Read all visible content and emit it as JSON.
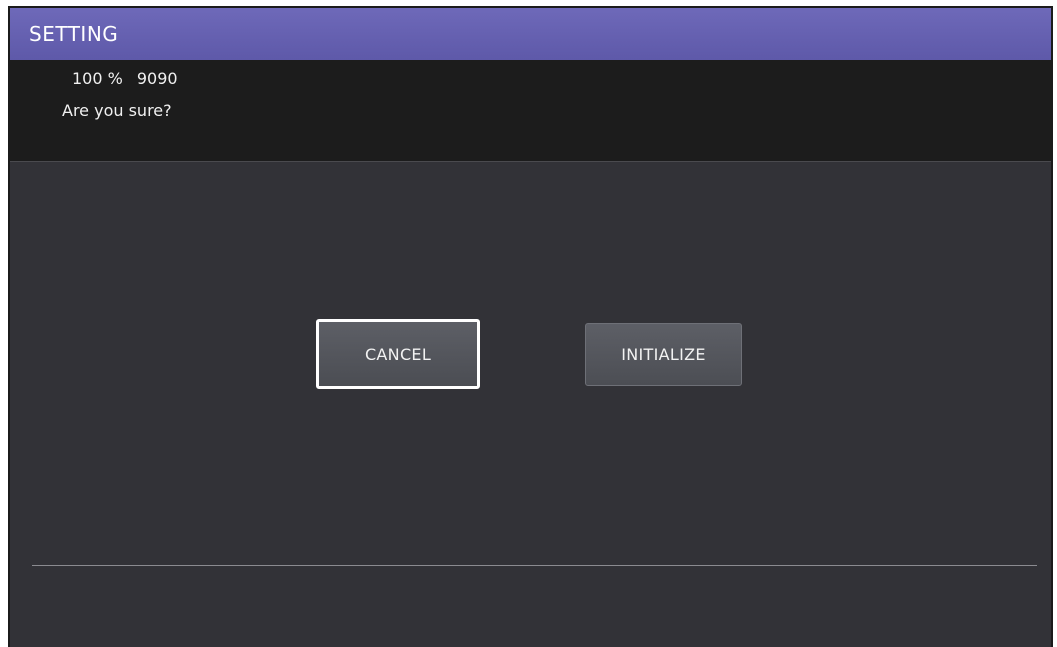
{
  "header": {
    "title": "SETTING"
  },
  "message": {
    "percent": "100 %",
    "code": "9090",
    "prompt": "Are you sure?"
  },
  "actions": {
    "cancel_label": "CANCEL",
    "initialize_label": "INITIALIZE"
  },
  "colors": {
    "title_bar": "#6964b4",
    "message_bg": "#1c1c1c",
    "panel_bg": "#323237",
    "button_bg": "#55575d",
    "focus_border": "#ffffff"
  }
}
